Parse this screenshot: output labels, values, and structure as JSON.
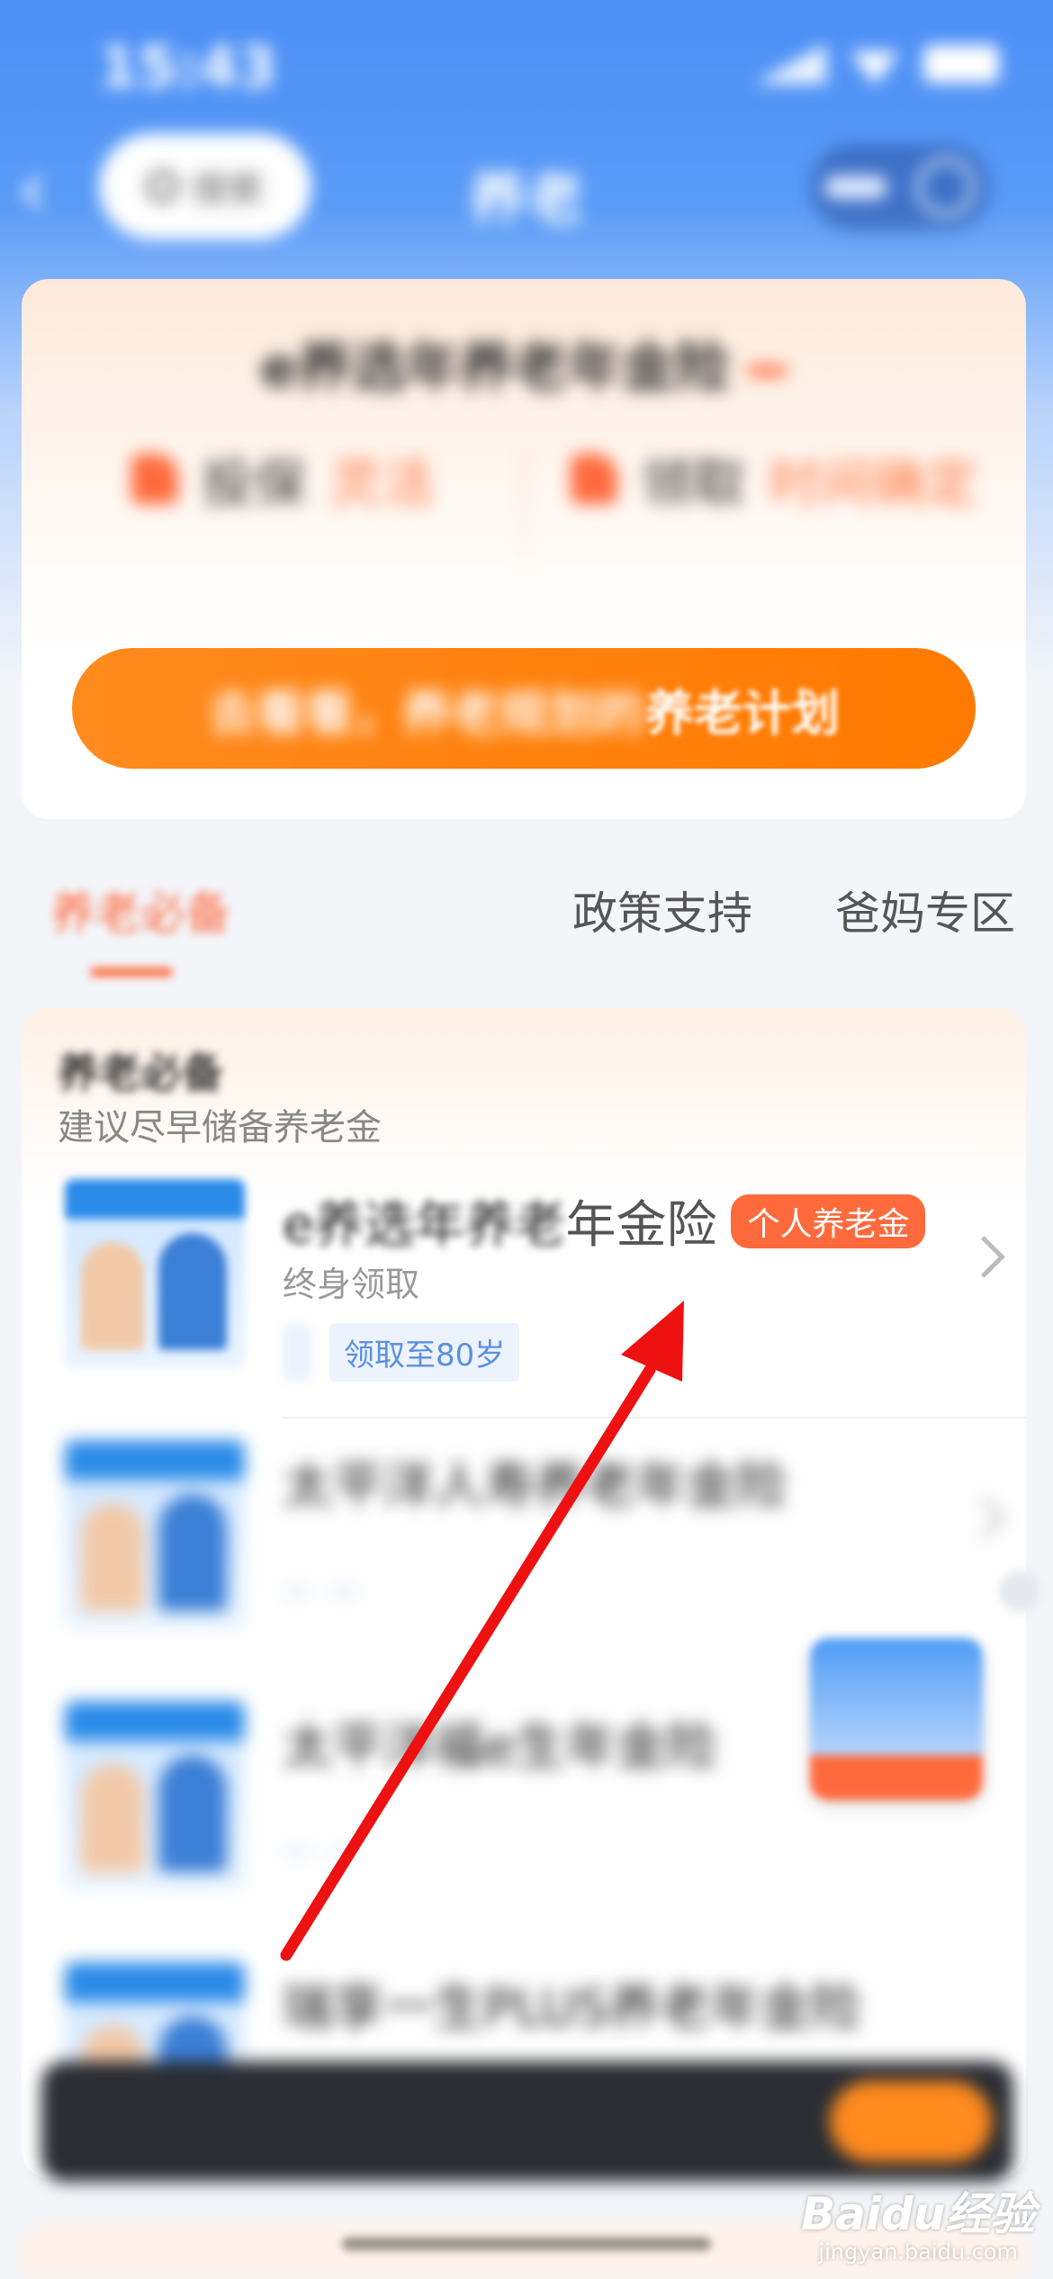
{
  "status_bar": {
    "time": "15:43"
  },
  "nav": {
    "back_glyph": "‹",
    "search_label": "搜索",
    "title": "养老"
  },
  "promo": {
    "title": "e养选年养老年金险",
    "tag": "",
    "feature_left": {
      "label": "投保",
      "highlight": "灵活",
      "sub": ""
    },
    "feature_right": {
      "label": "领取",
      "highlight": "时间确定",
      "sub": ""
    },
    "cta_blur": "去看看，养老规划的",
    "cta_clear": "养老计划"
  },
  "tabs": [
    "养老必备",
    "",
    "政策支持",
    "爸妈专区"
  ],
  "section": {
    "title": "养老必备",
    "subtitle_blur": "",
    "subtitle_clear": "建议尽早储备养老金"
  },
  "products": [
    {
      "name_blur": "e养选年养老",
      "name_clear": "年金险",
      "badge": "个人养老金",
      "desc_blur": "",
      "desc_clear": "终身领取",
      "chips": [
        "",
        "领取至80岁"
      ],
      "thumb_label": ""
    },
    {
      "name_blur": "太平洋人寿养老年金险",
      "name_clear": "",
      "badge": "",
      "desc_blur": "",
      "desc_clear": "",
      "chips": [
        "",
        ""
      ],
      "thumb_label": ""
    },
    {
      "name_blur": "太平洋福e生年金险",
      "name_clear": "",
      "badge": "",
      "desc_blur": "",
      "desc_clear": "",
      "chips": [
        "",
        ""
      ],
      "thumb_label": ""
    },
    {
      "name_blur": "瑞享一生PLUS养老年金险",
      "name_clear": "",
      "badge": "",
      "desc_blur": "",
      "desc_clear": "",
      "chips": [],
      "thumb_label": ""
    }
  ],
  "banner": {
    "text": "",
    "button": ""
  },
  "watermark": {
    "logo": "Baidu经验",
    "url": "jingyan.baidu.com"
  },
  "colors": {
    "primary_blue": "#4c8ff6",
    "accent_orange": "#ff7a00",
    "badge_orange": "#ff6a3d",
    "annotation_red": "#ee1111"
  }
}
